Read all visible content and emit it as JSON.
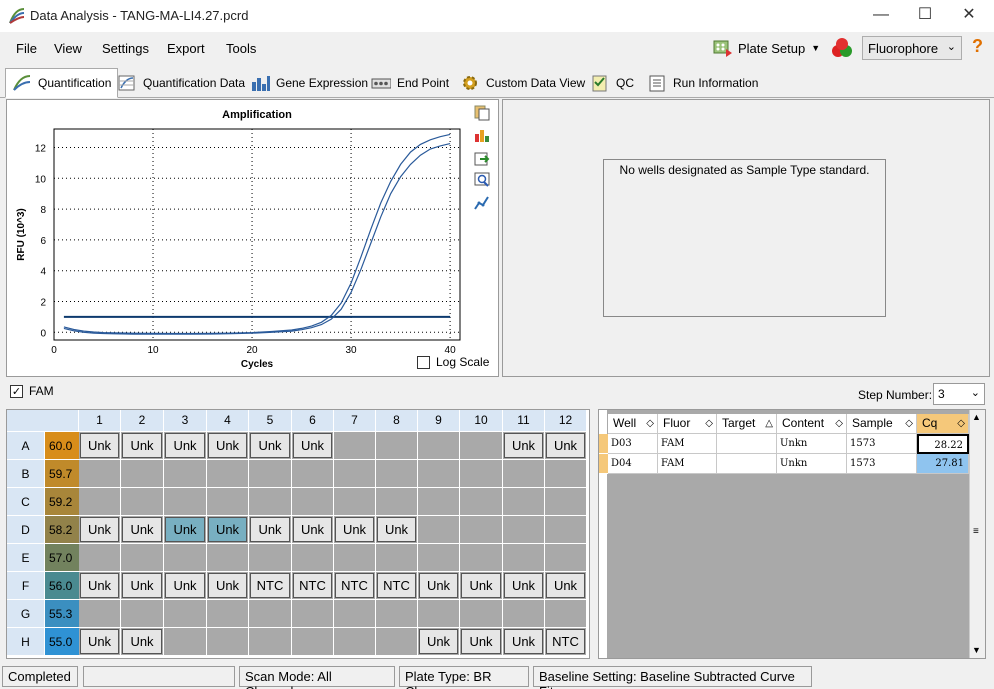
{
  "window": {
    "title": "Data Analysis - TANG-MA-LI4.27.pcrd",
    "min_icon": "minimize-icon",
    "max_icon": "maximize-icon",
    "close_icon": "close-icon"
  },
  "menu": {
    "file": "File",
    "view": "View",
    "settings": "Settings",
    "export": "Export",
    "tools": "Tools",
    "plate_setup": "Plate Setup",
    "fluorophore": "Fluorophore",
    "help_icon": "help-icon"
  },
  "tabs": [
    {
      "label": "Quantification"
    },
    {
      "label": "Quantification Data"
    },
    {
      "label": "Gene Expression"
    },
    {
      "label": "End Point"
    },
    {
      "label": "Custom Data View"
    },
    {
      "label": "QC"
    },
    {
      "label": "Run Information"
    }
  ],
  "chart_data": {
    "type": "line",
    "title": "Amplification",
    "xlabel": "Cycles",
    "ylabel": "RFU (10^3)",
    "xlim": [
      0,
      41
    ],
    "ylim": [
      -0.5,
      13.2
    ],
    "xticks": [
      0,
      10,
      20,
      30,
      40
    ],
    "yticks": [
      0,
      2,
      4,
      6,
      8,
      10,
      12
    ],
    "grid": true,
    "threshold": 1.0,
    "series": [
      {
        "x": [
          1,
          2,
          3,
          4,
          5,
          6,
          8,
          10,
          12,
          14,
          16,
          18,
          20,
          22,
          24,
          25,
          26,
          27,
          28,
          29,
          30,
          31,
          32,
          33,
          34,
          35,
          36,
          37,
          38,
          39,
          40
        ],
        "values": [
          0.35,
          0.18,
          0.08,
          0.02,
          -0.02,
          -0.04,
          -0.06,
          -0.07,
          -0.08,
          -0.08,
          -0.07,
          -0.05,
          -0.02,
          0.05,
          0.15,
          0.25,
          0.4,
          0.65,
          1.1,
          1.9,
          3.2,
          4.9,
          6.7,
          8.4,
          9.8,
          10.9,
          11.7,
          12.2,
          12.5,
          12.7,
          12.85
        ]
      },
      {
        "x": [
          1,
          2,
          3,
          4,
          5,
          6,
          8,
          10,
          12,
          14,
          16,
          18,
          20,
          22,
          24,
          25,
          26,
          27,
          28,
          29,
          30,
          31,
          32,
          33,
          34,
          35,
          36,
          37,
          38,
          39,
          40
        ],
        "values": [
          0.25,
          0.1,
          0.0,
          -0.05,
          -0.08,
          -0.1,
          -0.12,
          -0.12,
          -0.12,
          -0.12,
          -0.11,
          -0.09,
          -0.06,
          0.0,
          0.08,
          0.17,
          0.3,
          0.5,
          0.85,
          1.5,
          2.6,
          4.1,
          5.8,
          7.5,
          9.0,
          10.1,
          10.9,
          11.5,
          11.9,
          12.1,
          12.25
        ]
      }
    ]
  },
  "chart": {
    "log_scale_label": "Log Scale",
    "tool_icons": [
      "copy-icon",
      "chart-settings-icon",
      "export-icon",
      "zoom-icon",
      "trace-icon"
    ]
  },
  "right_panel": {
    "message": "No wells designated as Sample Type standard."
  },
  "fam": {
    "label": "FAM",
    "step_label": "Step Number:",
    "step_value": "3"
  },
  "plate": {
    "columns": [
      "1",
      "2",
      "3",
      "4",
      "5",
      "6",
      "7",
      "8",
      "9",
      "10",
      "11",
      "12"
    ],
    "rows": [
      {
        "label": "A",
        "temp": "60.0",
        "wells": [
          "Unk",
          "Unk",
          "Unk",
          "Unk",
          "Unk",
          "Unk",
          "",
          "",
          "",
          "",
          "Unk",
          "Unk"
        ]
      },
      {
        "label": "B",
        "temp": "59.7",
        "wells": [
          "",
          "",
          "",
          "",
          "",
          "",
          "",
          "",
          "",
          "",
          "",
          ""
        ]
      },
      {
        "label": "C",
        "temp": "59.2",
        "wells": [
          "",
          "",
          "",
          "",
          "",
          "",
          "",
          "",
          "",
          "",
          "",
          ""
        ]
      },
      {
        "label": "D",
        "temp": "58.2",
        "wells": [
          "Unk",
          "Unk",
          "Unk",
          "Unk",
          "Unk",
          "Unk",
          "Unk",
          "Unk",
          "",
          "",
          "",
          ""
        ]
      },
      {
        "label": "E",
        "temp": "57.0",
        "wells": [
          "",
          "",
          "",
          "",
          "",
          "",
          "",
          "",
          "",
          "",
          "",
          ""
        ]
      },
      {
        "label": "F",
        "temp": "56.0",
        "wells": [
          "Unk",
          "Unk",
          "Unk",
          "Unk",
          "NTC",
          "NTC",
          "NTC",
          "NTC",
          "Unk",
          "Unk",
          "Unk",
          "Unk"
        ]
      },
      {
        "label": "G",
        "temp": "55.3",
        "wells": [
          "",
          "",
          "",
          "",
          "",
          "",
          "",
          "",
          "",
          "",
          "",
          ""
        ]
      },
      {
        "label": "H",
        "temp": "55.0",
        "wells": [
          "Unk",
          "Unk",
          "",
          "",
          "",
          "",
          "",
          "",
          "Unk",
          "Unk",
          "Unk",
          "NTC"
        ]
      }
    ],
    "temp_colors": [
      "#d88d1a",
      "#c08a2a",
      "#a8863a",
      "#92824a",
      "#72825e",
      "#4a8a90",
      "#3b8fc0",
      "#2f92d4"
    ],
    "selected": [
      "D3",
      "D4"
    ]
  },
  "table": {
    "headers": [
      "Well",
      "Fluor",
      "Target",
      "Content",
      "Sample",
      "Cq"
    ],
    "rows": [
      {
        "well": "D03",
        "fluor": "FAM",
        "target": "",
        "content": "Unkn",
        "sample": "1573",
        "cq": "28.22"
      },
      {
        "well": "D04",
        "fluor": "FAM",
        "target": "",
        "content": "Unkn",
        "sample": "1573",
        "cq": "27.81"
      }
    ]
  },
  "status": {
    "state": "Completed",
    "scan_mode": "Scan Mode: All Channels",
    "plate_type": "Plate Type: BR Clear",
    "baseline": "Baseline Setting: Baseline Subtracted Curve Fit"
  }
}
